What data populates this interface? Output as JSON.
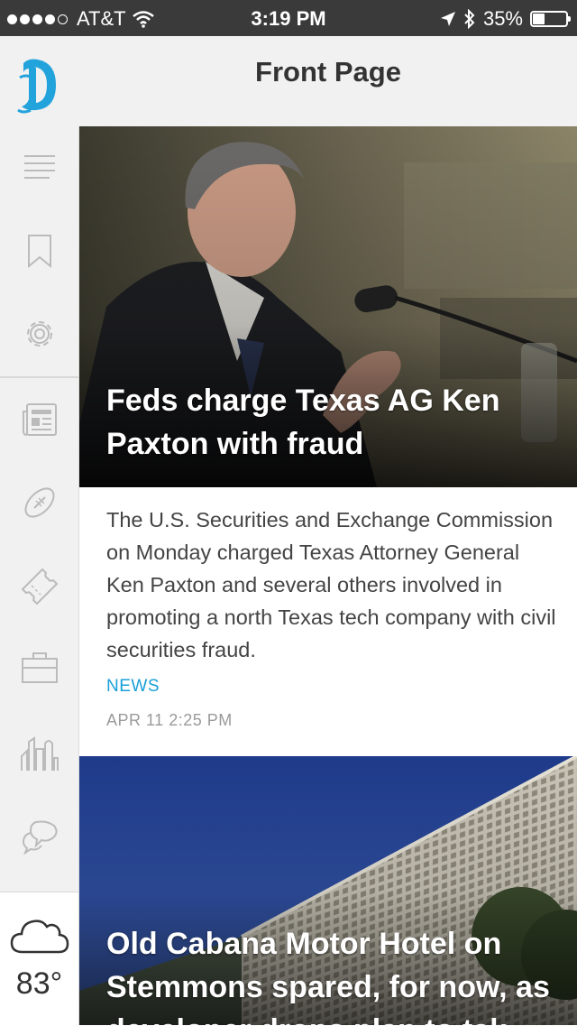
{
  "status_bar": {
    "carrier": "AT&T",
    "time": "3:19 PM",
    "battery": "35%",
    "battery_level": 0.35
  },
  "header": {
    "title": "Front Page",
    "logo_icon": "dallas-news-logo"
  },
  "sidebar": {
    "items": [
      {
        "icon": "menu-icon"
      },
      {
        "icon": "bookmark-icon"
      },
      {
        "icon": "settings-icon"
      },
      {
        "icon": "news-icon"
      },
      {
        "icon": "sports-icon"
      },
      {
        "icon": "ticket-icon"
      },
      {
        "icon": "business-icon"
      },
      {
        "icon": "city-icon"
      },
      {
        "icon": "opinion-icon"
      }
    ],
    "weather": {
      "temp": "83°",
      "icon": "cloud-icon"
    }
  },
  "articles": [
    {
      "headline": "Feds charge Texas AG Ken Paxton with fraud",
      "summary": "The U.S. Securities and Exchange Commission on Monday charged Texas Attorney General Ken Paxton and several others involved in promoting a north Texas tech company with civil securities fraud.",
      "section": "NEWS",
      "timestamp": "APR 11 2:25 PM"
    },
    {
      "headline": "Old Cabana Motor Hotel on Stemmons spared, for now, as developer drops plan to tak"
    }
  ],
  "colors": {
    "accent": "#1a9fd8",
    "sidebar_bg": "#f1f1f1",
    "status_bar_bg": "#3a3a3a"
  }
}
